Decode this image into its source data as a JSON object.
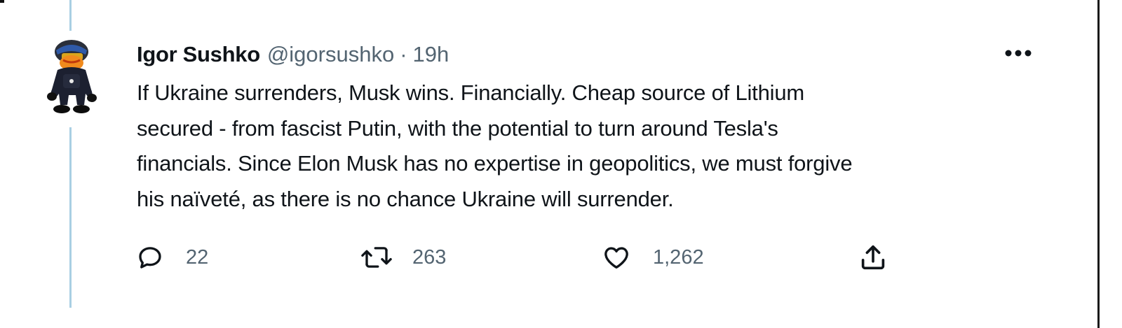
{
  "tweet": {
    "author": {
      "name": "Igor Sushko",
      "handle": "@igorsushko",
      "avatar_icon": "avatar-figure-icon"
    },
    "separator": "·",
    "timestamp": "19h",
    "more_icon": "more-horizontal-icon",
    "text_lines": [
      "If Ukraine surrenders, Musk wins. Financially. Cheap source of Lithium",
      "secured - from fascist Putin, with the potential to turn around Tesla's",
      "financials. Since Elon Musk has no expertise in geopolitics, we must forgive",
      "his naïveté, as there is no chance Ukraine will surrender."
    ],
    "actions": {
      "reply": {
        "icon": "reply-icon",
        "count": "22"
      },
      "retweet": {
        "icon": "retweet-icon",
        "count": "263"
      },
      "like": {
        "icon": "heart-icon",
        "count": "1,262"
      },
      "share": {
        "icon": "share-icon"
      }
    }
  },
  "colors": {
    "text_primary": "#0f1419",
    "text_secondary": "#536471",
    "thread_line": "#a9cfe3"
  }
}
